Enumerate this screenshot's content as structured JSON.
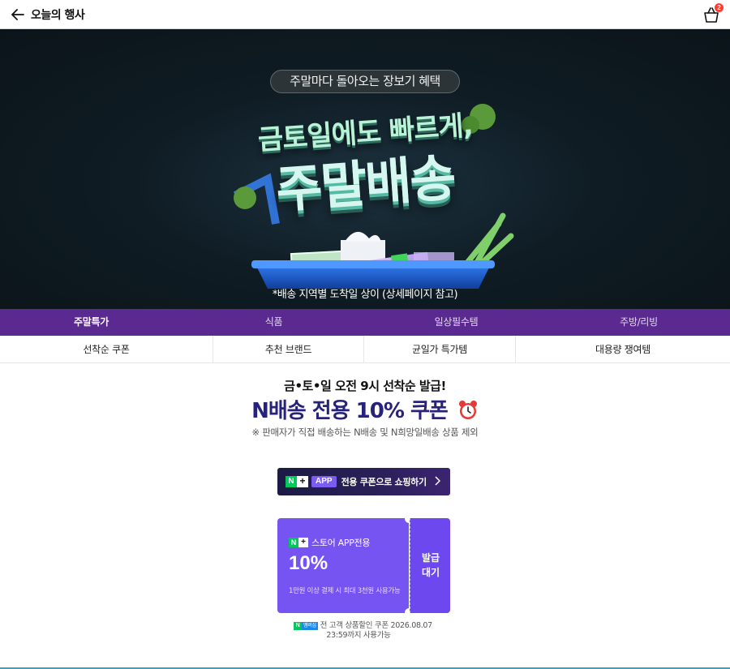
{
  "header": {
    "title": "오늘의 행사",
    "back_icon": "arrow-left-icon",
    "cart_icon": "shopping-bag-icon",
    "cart_count": "2"
  },
  "hero": {
    "tag": "주말마다 돌아오는 장보기 혜택",
    "headline": "금토일에도 빠르게,",
    "title": "주말배송",
    "note": "*배송 지역별 도착일 상이 (상세페이지 참고)",
    "illustration": "shopping-basket-illustration"
  },
  "category_tabs": [
    {
      "label": "주말특가",
      "active": true
    },
    {
      "label": "식품",
      "active": false
    },
    {
      "label": "일상필수템",
      "active": false
    },
    {
      "label": "주방/리빙",
      "active": false
    }
  ],
  "sub_tabs": [
    "선착순 쿠폰",
    "추천 브랜드",
    "균일가 특가템",
    "대용량 쟁여템"
  ],
  "coupon_section": {
    "kicker": "금•토•일 오전 9시 선착순 발급!",
    "title": "N배송 전용 10% 쿠폰",
    "title_icon": "alarm-clock-icon",
    "note": "※ 판매자가 직접 배송하는 N배송 및 N희망일배송 상품 제외",
    "app_button": {
      "n_badge": "N",
      "plus_badge": "+",
      "app_pill": "APP",
      "label": "전용 쿠폰으로 쇼핑하기",
      "chevron_icon": "chevron-right-icon"
    },
    "coupon": {
      "brand": "스토어 APP전용",
      "rate": "10%",
      "condition": "1만원 이상 결제 시 최대 3천원 사용가능",
      "status_line1": "발급",
      "status_line2": "대기"
    },
    "footnote": {
      "badge_n": "N",
      "badge_member": "멤버십",
      "line1": "전 고객 상품할인 쿠폰 2026.08.07",
      "line2": "23:59까지 사용가능"
    }
  },
  "colors": {
    "category_bar": "#5b2a90",
    "coupon_purple": "#7654f2",
    "title_navy": "#27237a",
    "naver_green": "#03c75a"
  }
}
